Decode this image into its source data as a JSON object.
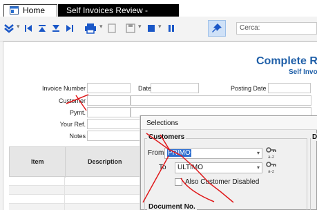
{
  "tabs": {
    "home_label": "Home",
    "active_label": "Self Invoices Review - Standard"
  },
  "toolbar": {
    "search_placeholder": "Cerca:",
    "icons": [
      "chevron-double-down-icon",
      "first-record-icon",
      "move-top-icon",
      "move-bottom-icon",
      "last-record-icon",
      "print-icon",
      "blank-page-icon",
      "save-icon",
      "stop-icon",
      "pause-icon",
      "pin-icon"
    ]
  },
  "report": {
    "title": "Complete Re",
    "subtitle": "Self Invoi",
    "fields": {
      "invoice_number": "Invoice Number",
      "date": "Date",
      "posting_date": "Posting Date",
      "customer": "Customer",
      "pymt": "Pymt.",
      "your_ref": "Your Ref.",
      "notes": "Notes"
    },
    "columns": {
      "item": "Item",
      "description": "Description"
    }
  },
  "dialog": {
    "title": "Selections",
    "customers_group": "Customers",
    "from_label": "From",
    "from_value": "PRIMO",
    "to_label": "To",
    "to_value": "ULTIMO",
    "also_disabled_label": "Also Customer Disabled",
    "also_disabled_checked": false,
    "document_group": "Document No.",
    "right_group_partial": "D"
  },
  "colors": {
    "accent_blue": "#1f5fa8",
    "toolbar_blue": "#1a57c7",
    "annotation_red": "#e0191b",
    "selection": "#2f6fd0"
  }
}
